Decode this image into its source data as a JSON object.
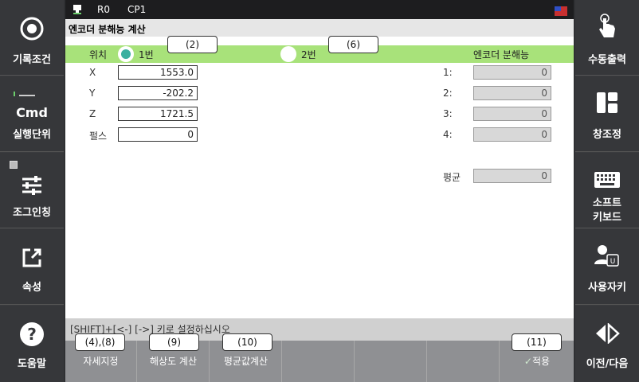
{
  "left_sidebar": [
    {
      "label": "기록조건",
      "icon": "record-circle-icon"
    },
    {
      "label": "실행단위",
      "icon": "cmd-icon",
      "icon_text": "Cmd"
    },
    {
      "label": "조그인칭",
      "icon": "sliders-icon"
    },
    {
      "label": "속성",
      "icon": "external-link-icon"
    },
    {
      "label": "도움말",
      "icon": "help-icon"
    }
  ],
  "right_sidebar": [
    {
      "label": "수동출력",
      "icon": "hand-pointer-icon"
    },
    {
      "label": "창조정",
      "icon": "window-layout-icon"
    },
    {
      "label_line1": "소프트",
      "label_line2": "키보드",
      "icon": "keyboard-icon"
    },
    {
      "label": "사용자키",
      "icon": "user-key-icon"
    },
    {
      "label": "이전/다음",
      "icon": "prev-next-icon"
    }
  ],
  "status": {
    "robot": "R0",
    "program": "CP1"
  },
  "title": "엔코더 분해능 계산",
  "position": {
    "label": "위치",
    "option1": "1번",
    "option2": "2번",
    "selected": "1번",
    "resolution_header": "엔코더 분해능"
  },
  "fields": [
    {
      "label": "X",
      "value": "1553.0"
    },
    {
      "label": "Y",
      "value": "-202.2"
    },
    {
      "label": "Z",
      "value": "1721.5"
    },
    {
      "label": "펄스",
      "value": "0"
    }
  ],
  "resolution": [
    {
      "label": "1:",
      "value": "0"
    },
    {
      "label": "2:",
      "value": "0"
    },
    {
      "label": "3:",
      "value": "0"
    },
    {
      "label": "4:",
      "value": "0"
    }
  ],
  "average": {
    "label": "평균",
    "value": "0"
  },
  "hint": "[SHIFT]+[<-] [->] 키로 설정하십시오",
  "fkeys": [
    "자세지정",
    "해상도 계산",
    "평균값계산",
    "",
    "",
    "",
    "적용"
  ],
  "callouts": [
    "(2)",
    "(6)",
    "(4),(8)",
    "(9)",
    "(10)",
    "(11)"
  ],
  "colors": {
    "green_bar": "#a8e27a",
    "radio_selected": "#3ab0a0"
  }
}
